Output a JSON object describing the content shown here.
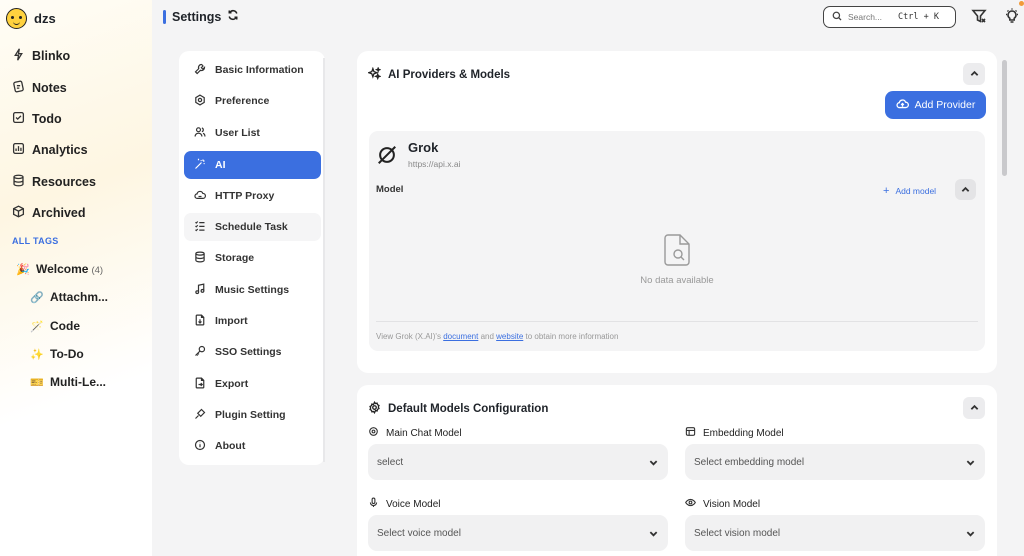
{
  "sidebar": {
    "username": "dzs",
    "nav": [
      {
        "label": "Blinko",
        "icon": "lightning-icon"
      },
      {
        "label": "Notes",
        "icon": "notes-icon"
      },
      {
        "label": "Todo",
        "icon": "todo-icon"
      },
      {
        "label": "Analytics",
        "icon": "analytics-icon"
      },
      {
        "label": "Resources",
        "icon": "database-icon"
      },
      {
        "label": "Archived",
        "icon": "archive-box-icon"
      }
    ],
    "tags_heading": "ALL TAGS",
    "tags": [
      {
        "emoji": "🎉",
        "label": "Welcome",
        "count": "(4)"
      },
      {
        "emoji": "🔗",
        "label": "Attachm..."
      },
      {
        "emoji": "🪄",
        "label": "Code"
      },
      {
        "emoji": "✨",
        "label": "To-Do"
      },
      {
        "emoji": "🎫",
        "label": "Multi-Le..."
      }
    ]
  },
  "header": {
    "title": "Settings",
    "search_placeholder": "Search...",
    "search_shortcut": "Ctrl + K"
  },
  "settings_menu": [
    {
      "label": "Basic Information",
      "icon": "wrench-icon"
    },
    {
      "label": "Preference",
      "icon": "preference-icon"
    },
    {
      "label": "User List",
      "icon": "users-icon"
    },
    {
      "label": "AI",
      "icon": "magic-wand-icon",
      "active": true
    },
    {
      "label": "HTTP Proxy",
      "icon": "cloud-icon"
    },
    {
      "label": "Schedule Task",
      "icon": "task-list-icon"
    },
    {
      "label": "Storage",
      "icon": "database-icon"
    },
    {
      "label": "Music Settings",
      "icon": "music-icon"
    },
    {
      "label": "Import",
      "icon": "import-icon"
    },
    {
      "label": "SSO Settings",
      "icon": "key-icon"
    },
    {
      "label": "Export",
      "icon": "export-icon"
    },
    {
      "label": "Plugin Setting",
      "icon": "plugin-icon"
    },
    {
      "label": "About",
      "icon": "info-icon"
    }
  ],
  "providers": {
    "title": "AI Providers & Models",
    "add_label": "Add Provider",
    "provider": {
      "name": "Grok",
      "url": "https://api.x.ai",
      "model_label": "Model",
      "add_model_label": "Add model",
      "empty_text": "No data available",
      "footer_prefix": "View Grok (X.AI)'s",
      "footer_link1": "document",
      "footer_mid": "and",
      "footer_link2": "website",
      "footer_suffix": "to obtain more information"
    }
  },
  "defaults": {
    "title": "Default Models Configuration",
    "fields": [
      {
        "label": "Main Chat Model",
        "value": "select",
        "icon": "chat-gear-icon"
      },
      {
        "label": "Embedding Model",
        "value": "Select embedding model",
        "icon": "embedding-icon"
      },
      {
        "label": "Voice Model",
        "value": "Select voice model",
        "icon": "microphone-icon"
      },
      {
        "label": "Vision Model",
        "value": "Select vision model",
        "icon": "eye-icon"
      }
    ]
  },
  "colors": {
    "accent": "#3b6fe0",
    "background": "#f4f4f5",
    "card": "#ffffff"
  }
}
